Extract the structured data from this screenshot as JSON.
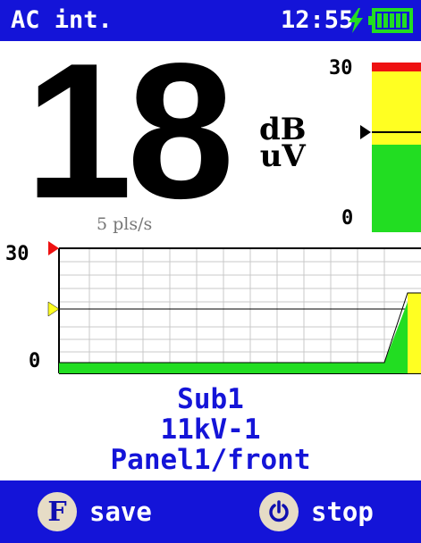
{
  "status": {
    "mode": "AC int.",
    "time": "12:55",
    "charge_icon": "lightning-icon",
    "battery_icon": "battery-icon"
  },
  "reading": {
    "value": "18",
    "unit_line1": "dB",
    "unit_line2": "uV",
    "rate": "5 pls/s"
  },
  "level_bar": {
    "max_label": "30",
    "min_label": "0",
    "marker_fraction": 0.6
  },
  "graph": {
    "max_label": "30",
    "min_label": "0"
  },
  "location": {
    "line1": "Sub1",
    "line2": "11kV-1",
    "line3": "Panel1/front"
  },
  "softkeys": [
    {
      "key": "F",
      "label": "save",
      "icon": "f-key-icon"
    },
    {
      "key": "power",
      "label": "stop",
      "icon": "power-icon"
    }
  ],
  "colors": {
    "accent": "#1414d8",
    "green": "#22dd22",
    "yellow": "#ffff22",
    "red": "#ee1111"
  }
}
